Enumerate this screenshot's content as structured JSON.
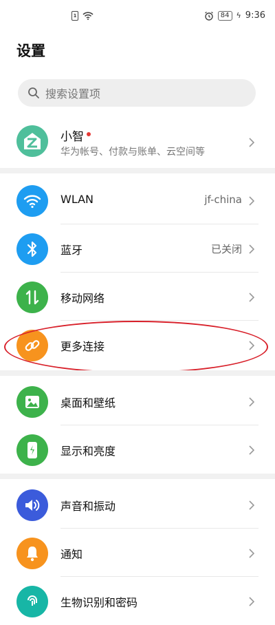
{
  "status_bar": {
    "sim_label": "1",
    "battery": "84",
    "time": "9:36"
  },
  "page": {
    "title": "设置"
  },
  "search": {
    "placeholder": "搜索设置项"
  },
  "account": {
    "name": "小智",
    "subtitle": "华为帐号、付款与账单、云空间等"
  },
  "groups": [
    {
      "items": [
        {
          "label": "WLAN",
          "value": "jf-china",
          "icon": "wifi-icon",
          "color": "#1e9df1"
        },
        {
          "label": "蓝牙",
          "value": "已关闭",
          "icon": "bluetooth-icon",
          "color": "#1e9df1"
        },
        {
          "label": "移动网络",
          "value": "",
          "icon": "mobile-data-icon",
          "color": "#3db24b"
        },
        {
          "label": "更多连接",
          "value": "",
          "icon": "link-icon",
          "color": "#f7931e"
        }
      ]
    },
    {
      "items": [
        {
          "label": "桌面和壁纸",
          "value": "",
          "icon": "wallpaper-icon",
          "color": "#3db24b"
        },
        {
          "label": "显示和亮度",
          "value": "",
          "icon": "display-icon",
          "color": "#3db24b"
        }
      ]
    },
    {
      "items": [
        {
          "label": "声音和振动",
          "value": "",
          "icon": "sound-icon",
          "color": "#3b5bdb"
        },
        {
          "label": "通知",
          "value": "",
          "icon": "bell-icon",
          "color": "#f7931e"
        },
        {
          "label": "生物识别和密码",
          "value": "",
          "icon": "fingerprint-icon",
          "color": "#17b6a6"
        }
      ]
    }
  ]
}
